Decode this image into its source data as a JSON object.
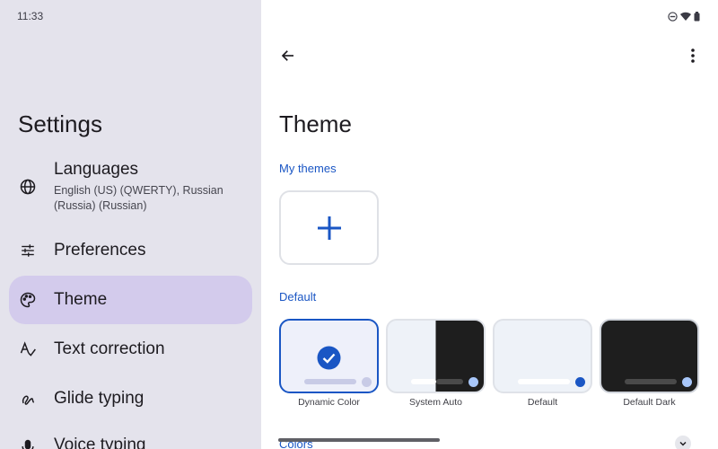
{
  "status_bar": {
    "time": "11:33"
  },
  "sidebar": {
    "title": "Settings",
    "items": [
      {
        "label": "Languages",
        "sublabel": "English (US) (QWERTY), Russian (Russia) (Russian)",
        "icon": "globe-icon"
      },
      {
        "label": "Preferences",
        "icon": "sliders-icon"
      },
      {
        "label": "Theme",
        "icon": "palette-icon",
        "active": true
      },
      {
        "label": "Text correction",
        "icon": "text-correction-icon"
      },
      {
        "label": "Glide typing",
        "icon": "glide-icon"
      },
      {
        "label": "Voice typing",
        "icon": "mic-icon"
      }
    ]
  },
  "main": {
    "title": "Theme",
    "my_themes_label": "My themes",
    "default_label": "Default",
    "themes": [
      {
        "name": "Dynamic Color",
        "selected": true
      },
      {
        "name": "System Auto"
      },
      {
        "name": "Default"
      },
      {
        "name": "Default Dark"
      }
    ],
    "colors_label": "Colors"
  },
  "colors": {
    "accent": "#1a56c4",
    "sidebar_bg": "#e4e3ec",
    "active_bg": "#d3cbec"
  }
}
